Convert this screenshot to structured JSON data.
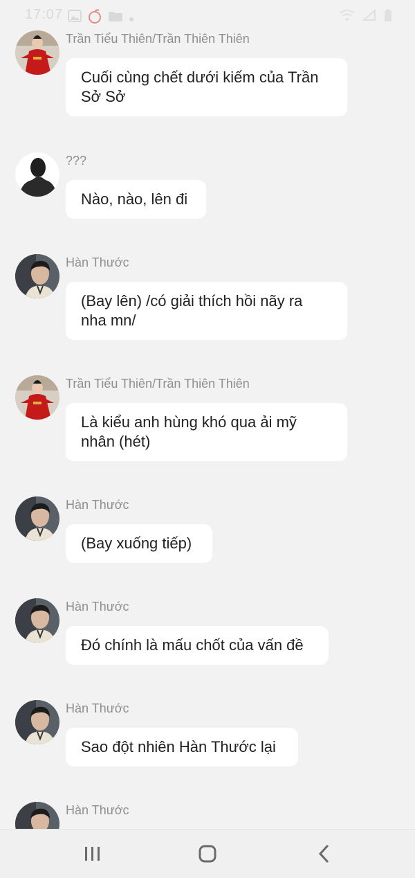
{
  "status_bar": {
    "time": "17:07",
    "icons_left": [
      "image-icon",
      "peach-icon",
      "folder-icon",
      "dot-icon"
    ],
    "icons_right": [
      "wifi-icon",
      "signal-icon",
      "battery-icon"
    ]
  },
  "messages": [
    {
      "sender": "Trần Tiểu Thiên/Trần Thiên Thiên",
      "avatar": "red-dress-avatar",
      "text": "Cuối cùng chết dưới kiếm của Trần Sở Sở"
    },
    {
      "sender": "???",
      "avatar": "silhouette-avatar",
      "text": "Nào, nào, lên đi"
    },
    {
      "sender": "Hàn Thước",
      "avatar": "young-man-avatar",
      "text": "(Bay lên) /có giải thích hồi nãy ra nha mn/"
    },
    {
      "sender": "Trần Tiểu Thiên/Trần Thiên Thiên",
      "avatar": "red-dress-avatar",
      "text": "Là kiểu anh hùng khó qua ải mỹ nhân (hét)"
    },
    {
      "sender": "Hàn Thước",
      "avatar": "young-man-avatar",
      "text": "(Bay xuống tiếp)"
    },
    {
      "sender": "Hàn Thước",
      "avatar": "young-man-avatar",
      "text": "Đó chính là mấu chốt của vấn đề"
    },
    {
      "sender": "Hàn Thước",
      "avatar": "young-man-avatar",
      "text": "Sao đột nhiên Hàn Thước lại"
    },
    {
      "sender": "Hàn Thước",
      "avatar": "young-man-avatar",
      "text": ""
    }
  ],
  "nav_bar": {
    "buttons": [
      "recent-apps-icon",
      "home-icon",
      "back-icon"
    ]
  }
}
